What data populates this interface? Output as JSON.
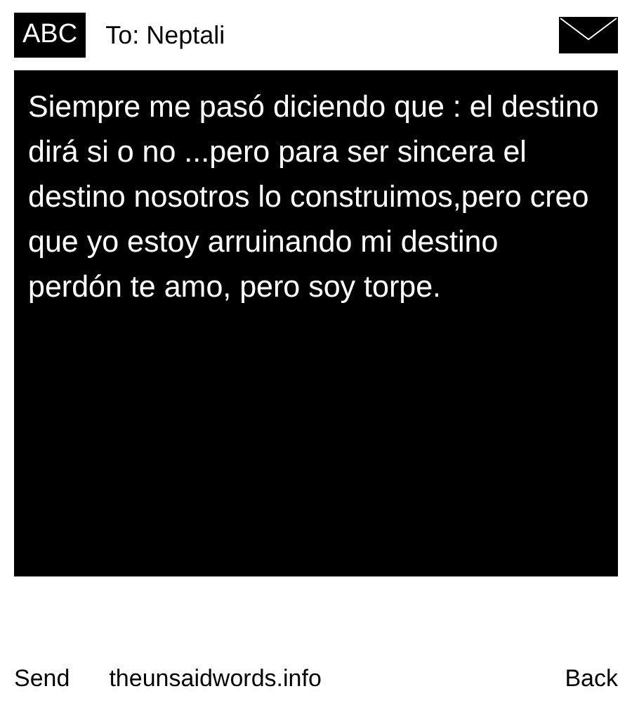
{
  "header": {
    "input_mode": "ABC",
    "recipient": "To: Neptali"
  },
  "message": {
    "text": "Siempre me pasó diciendo que : el destino dirá si o no ...pero para ser sincera el destino nosotros lo construimos,pero creo que yo estoy arruinando mi destino\nperdón te amo, pero soy torpe."
  },
  "softkeys": {
    "left": "Send",
    "center": "theunsaidwords.info",
    "right": "Back"
  }
}
